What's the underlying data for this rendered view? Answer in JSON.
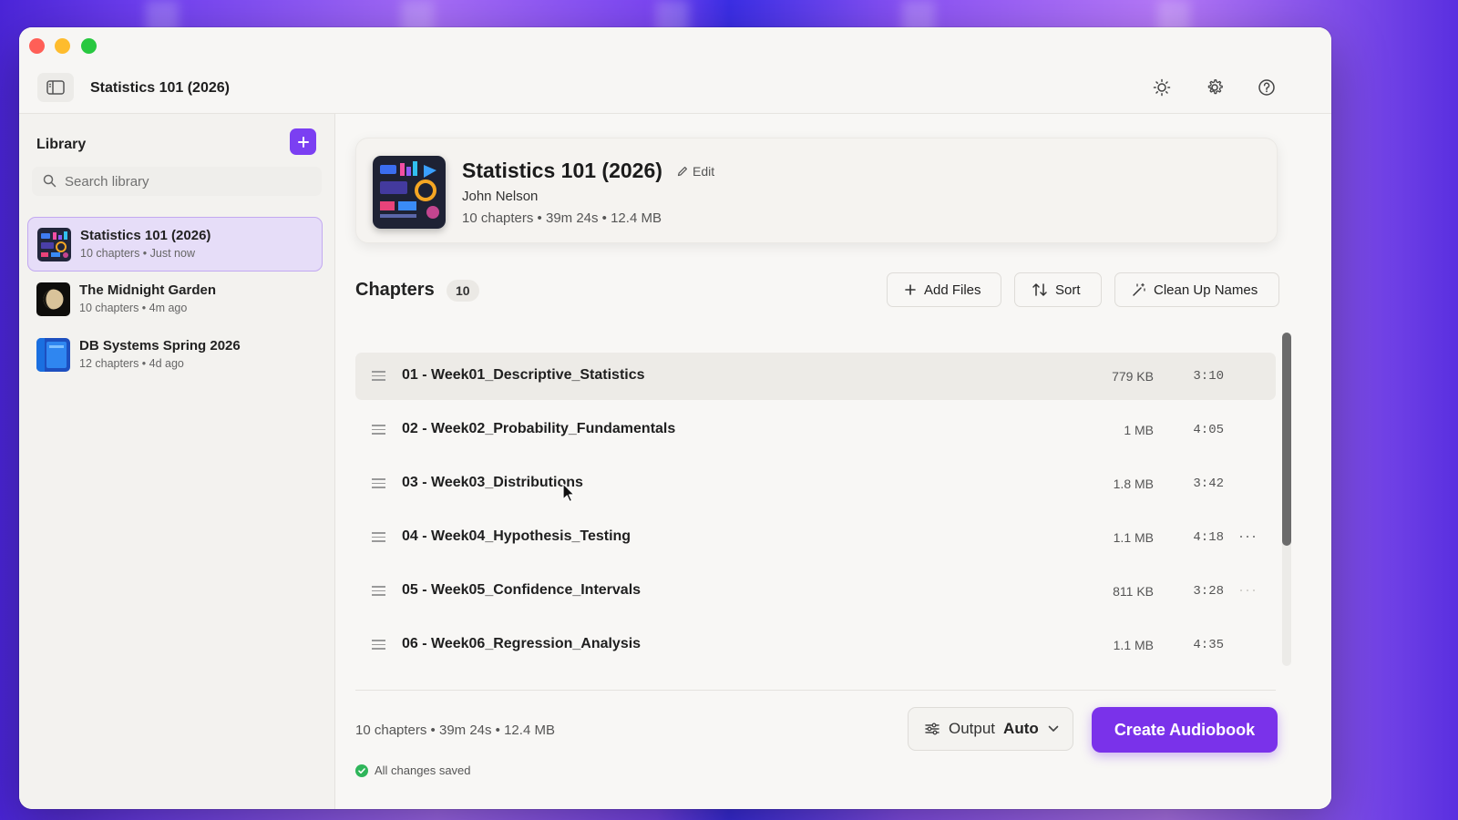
{
  "window": {
    "title": "Statistics 101 (2026)"
  },
  "sidebar": {
    "title": "Library",
    "search_placeholder": "Search library",
    "items": [
      {
        "name": "Statistics 101 (2026)",
        "meta": "10 chapters  •  Just now",
        "thumb": "stats-cover",
        "active": true
      },
      {
        "name": "The Midnight Garden",
        "meta": "10 chapters  •  4m ago",
        "thumb": "moon-cover",
        "active": false
      },
      {
        "name": "DB Systems Spring 2026",
        "meta": "12 chapters  •  4d ago",
        "thumb": "blue-book-cover",
        "active": false
      }
    ]
  },
  "hero": {
    "title": "Statistics 101 (2026)",
    "edit_label": "Edit",
    "author": "John Nelson",
    "stats": "10 chapters • 39m 24s • 12.4 MB"
  },
  "chapters": {
    "title": "Chapters",
    "count": "10",
    "toolbar": {
      "add_files": "Add Files",
      "sort": "Sort",
      "clean_up": "Clean Up Names"
    },
    "rows": [
      {
        "name": "01 - Week01_Descriptive_Statistics",
        "size": "779 KB",
        "duration": "3:10"
      },
      {
        "name": "02 - Week02_Probability_Fundamentals",
        "size": "1 MB",
        "duration": "4:05"
      },
      {
        "name": "03 - Week03_Distributions",
        "size": "1.8 MB",
        "duration": "3:42"
      },
      {
        "name": "04 - Week04_Hypothesis_Testing",
        "size": "1.1 MB",
        "duration": "4:18"
      },
      {
        "name": "05 - Week05_Confidence_Intervals",
        "size": "811 KB",
        "duration": "3:28"
      },
      {
        "name": "06 - Week06_Regression_Analysis",
        "size": "1.1 MB",
        "duration": "4:35"
      }
    ],
    "more_glyph": "···"
  },
  "footer": {
    "stats": "10 chapters • 39m 24s • 12.4 MB",
    "saved": "All changes saved",
    "output_label": "Output",
    "output_value": "Auto",
    "create": "Create Audiobook"
  },
  "colors": {
    "accent": "#7a32ea",
    "saved": "#2fb55a"
  }
}
